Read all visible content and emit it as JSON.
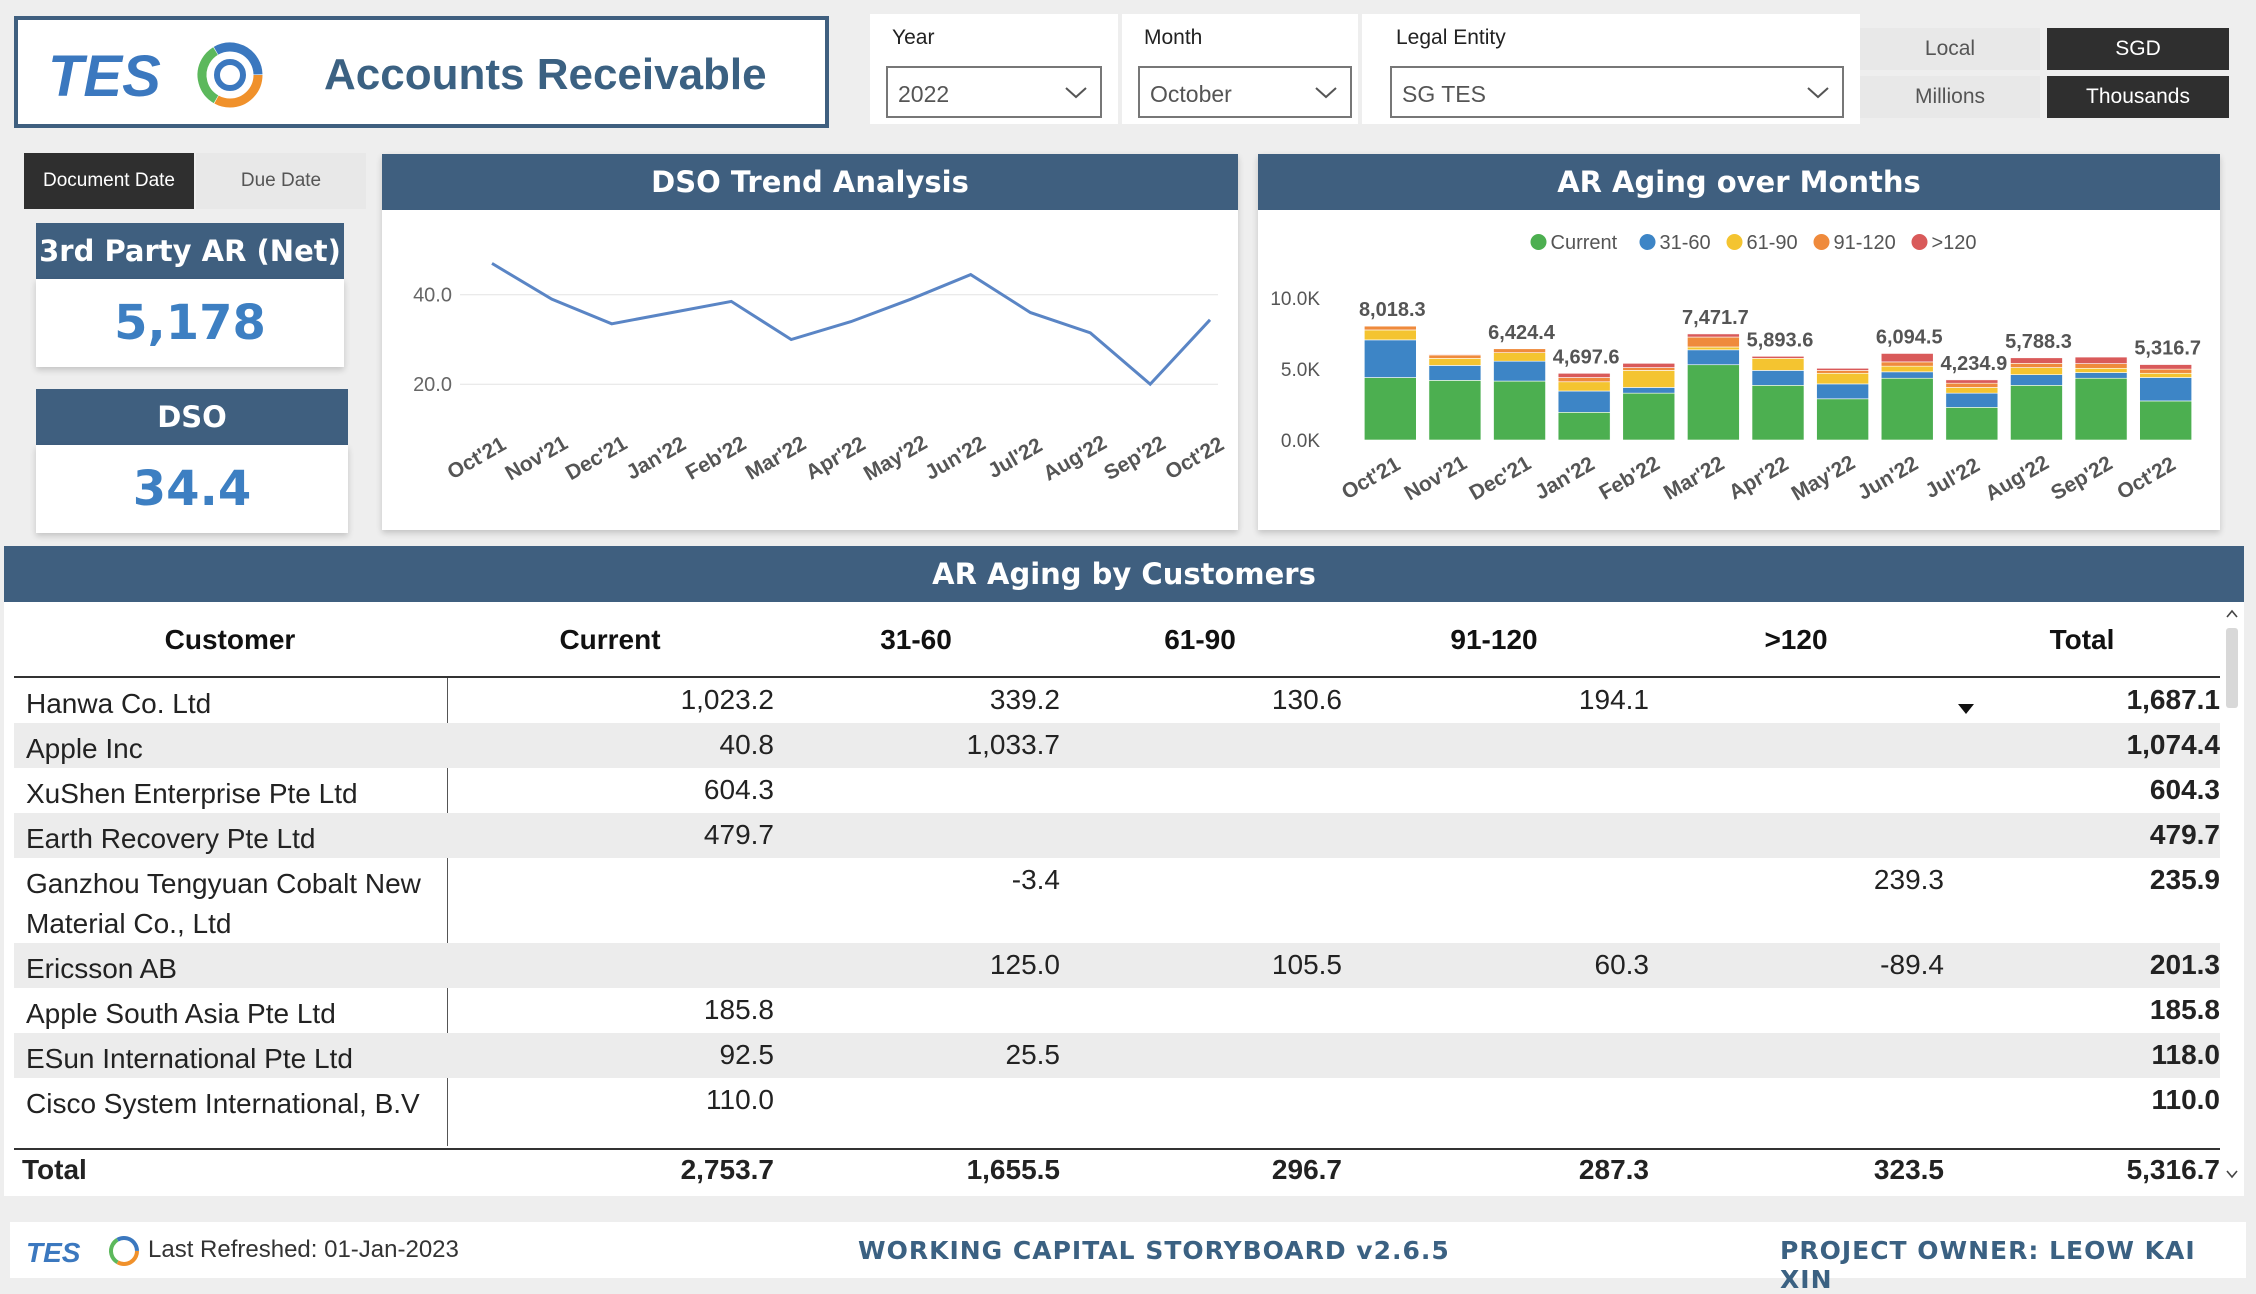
{
  "header": {
    "title": "Accounts Receivable",
    "logo_text": "TES"
  },
  "filters": {
    "year": {
      "label": "Year",
      "value": "2022"
    },
    "month": {
      "label": "Month",
      "value": "October"
    },
    "entity": {
      "label": "Legal Entity",
      "value": "SG TES"
    }
  },
  "currency_toggle": {
    "local": "Local",
    "sgd": "SGD",
    "selected": "SGD"
  },
  "unit_toggle": {
    "millions": "Millions",
    "thousands": "Thousands",
    "selected": "Thousands"
  },
  "date_toggle": {
    "document": "Document Date",
    "due": "Due Date",
    "selected": "Document Date"
  },
  "kpis": {
    "ar": {
      "title": "3rd Party AR (Net)",
      "value": "5,178"
    },
    "dso": {
      "title": "DSO",
      "value": "34.4"
    }
  },
  "dso_chart": {
    "title": "DSO Trend Analysis",
    "chart_data": {
      "type": "line",
      "categories": [
        "Oct'21",
        "Nov'21",
        "Dec'21",
        "Jan'22",
        "Feb'22",
        "Mar'22",
        "Apr'22",
        "May'22",
        "Jun'22",
        "Jul'22",
        "Aug'22",
        "Sep'22",
        "Oct'22"
      ],
      "values": [
        47.0,
        39.0,
        33.5,
        36.0,
        38.5,
        30.0,
        34.0,
        39.0,
        44.5,
        36.0,
        31.5,
        20.0,
        34.4
      ],
      "yticks": [
        "40.0",
        "20.0"
      ],
      "ytick_values": [
        40,
        20
      ],
      "ylim": [
        12,
        50
      ],
      "grid": true,
      "line_color": "#5a85c5"
    }
  },
  "aging_chart": {
    "title": "AR Aging over Months",
    "chart_data": {
      "type": "bar",
      "stacked": true,
      "categories": [
        "Oct'21",
        "Nov'21",
        "Dec'21",
        "Jan'22",
        "Feb'22",
        "Mar'22",
        "Apr'22",
        "May'22",
        "Jun'22",
        "Jul'22",
        "Aug'22",
        "Sep'22",
        "Oct'22"
      ],
      "series": [
        {
          "name": "Current",
          "color": "#4caf50",
          "values": [
            4400,
            4200,
            4150,
            1950,
            3300,
            5300,
            3850,
            2900,
            4350,
            2300,
            3850,
            4350,
            2750
          ]
        },
        {
          "name": "31-60",
          "color": "#3d85c6",
          "values": [
            2650,
            1050,
            1400,
            1500,
            400,
            1050,
            1050,
            1050,
            450,
            1000,
            750,
            400,
            1650
          ]
        },
        {
          "name": "61-90",
          "color": "#f4c430",
          "values": [
            700,
            500,
            600,
            650,
            1200,
            200,
            850,
            750,
            400,
            400,
            500,
            300,
            300
          ]
        },
        {
          "name": "91-120",
          "color": "#ef8a3c",
          "values": [
            268,
            240,
            274,
            300,
            200,
            700,
            0,
            200,
            300,
            300,
            300,
            330,
            290
          ]
        },
        {
          "name": ">120",
          "color": "#d95a5a",
          "values": [
            0,
            50,
            0,
            298,
            300,
            221,
            144,
            150,
            594,
            235,
            388,
            460,
            323
          ]
        }
      ],
      "labels": [
        "8,018.3",
        "",
        "6,424.4",
        "4,697.6",
        "",
        "7,471.7",
        "5,893.6",
        "",
        "6,094.5",
        "4,234.9",
        "5,788.3",
        "",
        "5,316.7"
      ],
      "yticks": [
        "10.0K",
        "5.0K",
        "0.0K"
      ],
      "ytick_values": [
        10000,
        5000,
        0
      ],
      "ylim": [
        0,
        10000
      ],
      "legend_position": "top"
    }
  },
  "table": {
    "title": "AR Aging by Customers",
    "columns": [
      "Customer",
      "Current",
      "31-60",
      "61-90",
      "91-120",
      ">120",
      "Total"
    ],
    "rows": [
      [
        "Hanwa Co. Ltd",
        "1,023.2",
        "339.2",
        "130.6",
        "194.1",
        "",
        "1,687.1"
      ],
      [
        "Apple Inc",
        "40.8",
        "1,033.7",
        "",
        "",
        "",
        "1,074.4"
      ],
      [
        "XuShen Enterprise Pte Ltd",
        "604.3",
        "",
        "",
        "",
        "",
        "604.3"
      ],
      [
        "Earth Recovery Pte Ltd",
        "479.7",
        "",
        "",
        "",
        "",
        "479.7"
      ],
      [
        "Ganzhou Tengyuan Cobalt New",
        "",
        "-3.4",
        "",
        "",
        "239.3",
        "235.9"
      ],
      [
        "Ericsson AB",
        "",
        "125.0",
        "105.5",
        "60.3",
        "-89.4",
        "201.3"
      ],
      [
        "Apple South Asia Pte Ltd",
        "185.8",
        "",
        "",
        "",
        "",
        "185.8"
      ],
      [
        "ESun International Pte Ltd",
        "92.5",
        "25.5",
        "",
        "",
        "",
        "118.0"
      ],
      [
        "Cisco System International, B.V",
        "110.0",
        "",
        "",
        "",
        "",
        "110.0"
      ]
    ],
    "row5_line2": "Material Co., Ltd",
    "total": [
      "Total",
      "2,753.7",
      "1,655.5",
      "296.7",
      "287.3",
      "323.5",
      "5,316.7"
    ]
  },
  "footer": {
    "refreshed": "Last Refreshed: 01-Jan-2023",
    "center": "WORKING CAPITAL STORYBOARD v2.6.5",
    "right": "PROJECT OWNER: LEOW KAI XIN"
  }
}
